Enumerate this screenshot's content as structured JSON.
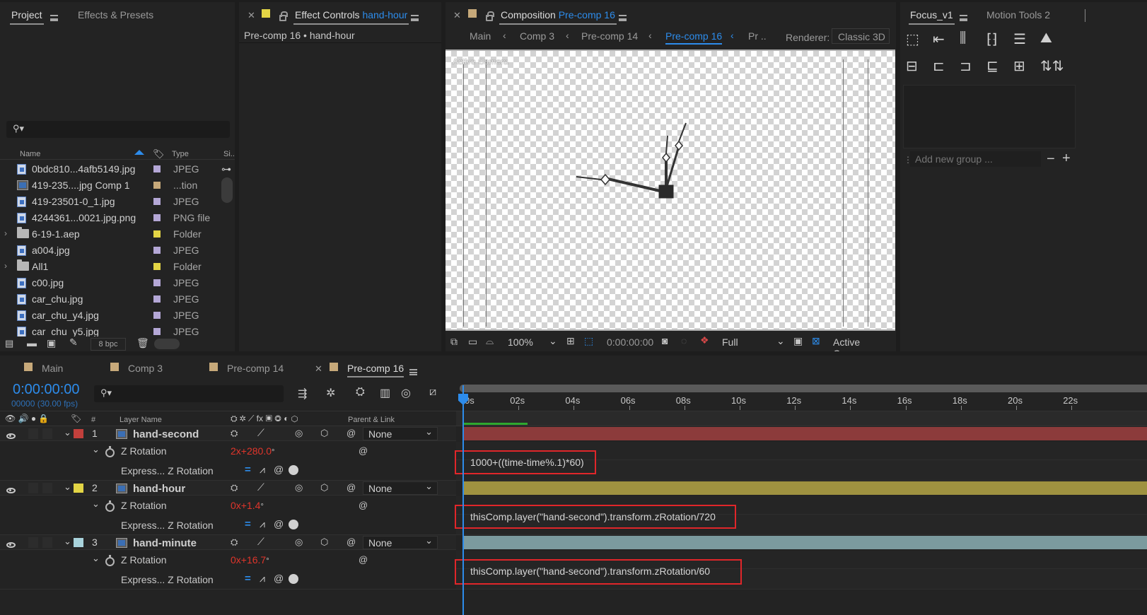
{
  "project_panel": {
    "tabs": [
      {
        "label": "Project"
      },
      {
        "label": "Effects & Presets"
      }
    ],
    "columns": {
      "name": "Name",
      "type": "Type",
      "size": "Si.."
    },
    "items": [
      {
        "name": "0bdc810...4afb5149.jpg",
        "type": "JPEG",
        "icon": "image-file-icon",
        "label_color": "#b4a7d6"
      },
      {
        "name": "419-235....jpg Comp 1",
        "type": "...tion",
        "icon": "composition-icon",
        "label_color": "#c7a97a"
      },
      {
        "name": "419-23501-0_1.jpg",
        "type": "JPEG",
        "icon": "image-file-icon",
        "label_color": "#b4a7d6"
      },
      {
        "name": "4244361...0021.jpg.png",
        "type": "PNG file",
        "icon": "image-file-icon",
        "label_color": "#b4a7d6"
      },
      {
        "name": "6-19-1.aep",
        "type": "Folder",
        "icon": "folder-icon",
        "label_color": "#e3d545"
      },
      {
        "name": "a004.jpg",
        "type": "JPEG",
        "icon": "image-file-icon",
        "label_color": "#b4a7d6"
      },
      {
        "name": "All1",
        "type": "Folder",
        "icon": "folder-icon",
        "label_color": "#e3d545"
      },
      {
        "name": "c00.jpg",
        "type": "JPEG",
        "icon": "image-file-icon",
        "label_color": "#b4a7d6"
      },
      {
        "name": "car_chu.jpg",
        "type": "JPEG",
        "icon": "image-file-icon",
        "label_color": "#b4a7d6"
      },
      {
        "name": "car_chu_y4.jpg",
        "type": "JPEG",
        "icon": "image-file-icon",
        "label_color": "#b4a7d6"
      },
      {
        "name": "car_chu_y5.jpg",
        "type": "JPEG",
        "icon": "image-file-icon",
        "label_color": "#b4a7d6"
      }
    ],
    "bpc": "8 bpc"
  },
  "effect_controls": {
    "title": "Effect Controls",
    "layer": "hand-hour",
    "subtitle": "Pre-comp 16 • hand-hour"
  },
  "composition": {
    "title": "Composition",
    "comp_name": "Pre-comp 16",
    "breadcrumbs": [
      {
        "label": "Main"
      },
      {
        "label": "Comp 3"
      },
      {
        "label": "Pre-comp 14"
      },
      {
        "label": "Pre-comp 16"
      },
      {
        "label": "Pr .."
      }
    ],
    "renderer_label": "Renderer:",
    "renderer": "Classic 3D",
    "view_label": "Active Camera",
    "zoom": "100%",
    "timecode": "0:00:00:00",
    "resolution": "Full",
    "camera": "Active Camera"
  },
  "focus_panel": {
    "tabs": [
      {
        "label": "Focus_v1"
      },
      {
        "label": "Motion Tools 2"
      }
    ],
    "add_group": "Add new group ..."
  },
  "timeline": {
    "tabs": [
      {
        "label": "Main",
        "color": "#c7a97a"
      },
      {
        "label": "Comp 3",
        "color": "#c7a97a"
      },
      {
        "label": "Pre-comp 14",
        "color": "#c7a97a"
      },
      {
        "label": "Pre-comp 16",
        "color": "#c7a97a"
      }
    ],
    "timecode": "0:00:00:00",
    "fps": "00000 (30.00 fps)",
    "headers": {
      "hash": "#",
      "layer_name": "Layer Name",
      "parent": "Parent & Link"
    },
    "ruler": [
      "0s",
      "02s",
      "04s",
      "06s",
      "08s",
      "10s",
      "12s",
      "14s",
      "16s",
      "18s",
      "20s",
      "22s"
    ],
    "layers": [
      {
        "index": "1",
        "name": "hand-second",
        "color": "#c2403c",
        "bar_color": "#8c3b3b",
        "parent": "None",
        "prop": "Z Rotation",
        "rev": "2x",
        "deg": "+280.0",
        "unit": "°",
        "expr_label": "Express... Z Rotation",
        "expression": "1000+((time-time%.1)*60)"
      },
      {
        "index": "2",
        "name": "hand-hour",
        "color": "#e3d545",
        "bar_color": "#9f9240",
        "parent": "None",
        "prop": "Z Rotation",
        "rev": "0x",
        "deg": "+1.4",
        "unit": "°",
        "expr_label": "Express... Z Rotation",
        "expression": "thisComp.layer(\"hand-second\").transform.zRotation/720"
      },
      {
        "index": "3",
        "name": "hand-minute",
        "color": "#a9d3dc",
        "bar_color": "#7b9a9e",
        "parent": "None",
        "prop": "Z Rotation",
        "rev": "0x",
        "deg": "+16.7",
        "unit": "°",
        "expr_label": "Express... Z Rotation",
        "expression": "thisComp.layer(\"hand-second\").transform.zRotation/60"
      }
    ]
  }
}
